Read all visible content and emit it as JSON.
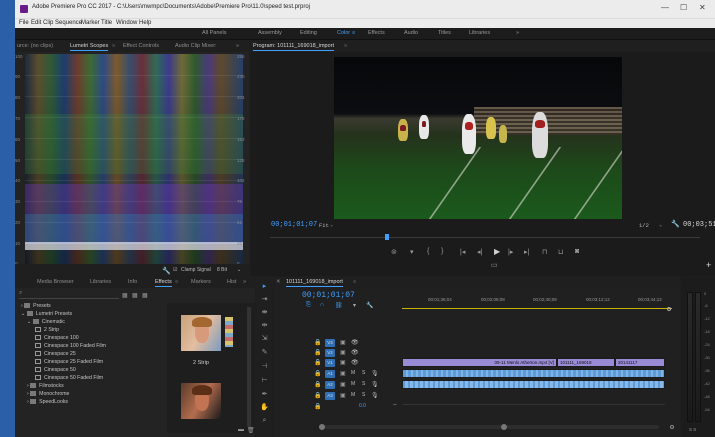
{
  "window": {
    "title": "Adobe Premiere Pro CC 2017 - C:\\Users\\mwmpc\\Documents\\Adobe\\Premiere Pro\\11.0\\speed test.prproj",
    "controls": [
      "—",
      "☐",
      "✕"
    ]
  },
  "menubar": [
    "File",
    "Edit",
    "Clip",
    "Sequence",
    "Marker",
    "Title",
    "Window",
    "Help"
  ],
  "workspaces": {
    "items": [
      "All Panels",
      "Assembly",
      "Editing",
      "Color",
      "Effects",
      "Audio",
      "Titles",
      "Libraries"
    ],
    "active": "Color",
    "more": "»"
  },
  "scope_panel": {
    "tabs": [
      "urce: (no clips)",
      "Lumetri Scopes",
      "Effect Controls",
      "Audio Clip Mixer:"
    ],
    "active_tab": "Lumetri Scopes",
    "more": "»",
    "left_scale": [
      "100",
      "90",
      "80",
      "70",
      "60",
      "50",
      "40",
      "30",
      "20",
      "10",
      "0"
    ],
    "right_scale": [
      "255",
      "230",
      "204",
      "178",
      "153",
      "128",
      "102",
      "76",
      "51",
      "25",
      "0"
    ],
    "clamp_label": "Clamp Signal",
    "bit_depth": "8 Bit"
  },
  "program": {
    "tab": "Program: 101111_169018_import",
    "timecode": "00;01;01;07",
    "fit": "Fit",
    "resolution": "1/2",
    "duration": "00;03;51;43"
  },
  "effects_panel": {
    "tabs": [
      "Media Browser",
      "Libraries",
      "Info",
      "Effects",
      "Markers",
      "Hist"
    ],
    "active_tab": "Effects",
    "more": "»",
    "items": [
      {
        "label": "Presets",
        "kind": "folder",
        "indent": 0
      },
      {
        "label": "Lumetri Presets",
        "kind": "folder",
        "indent": 0
      },
      {
        "label": "Cinematic",
        "kind": "folder",
        "indent": 1
      },
      {
        "label": "2 Strip",
        "kind": "preset",
        "indent": 2
      },
      {
        "label": "Cinespace 100",
        "kind": "preset",
        "indent": 2
      },
      {
        "label": "Cinespace 100 Faded Film",
        "kind": "preset",
        "indent": 2
      },
      {
        "label": "Cinespace 25",
        "kind": "preset",
        "indent": 2
      },
      {
        "label": "Cinespace 25 Faded Film",
        "kind": "preset",
        "indent": 2
      },
      {
        "label": "Cinespace 50",
        "kind": "preset",
        "indent": 2
      },
      {
        "label": "Cinespace 50 Faded Film",
        "kind": "preset",
        "indent": 2
      },
      {
        "label": "Filmstocks",
        "kind": "folder",
        "indent": 1
      },
      {
        "label": "Monochrome",
        "kind": "folder",
        "indent": 1
      },
      {
        "label": "SpeedLooks",
        "kind": "folder",
        "indent": 1
      }
    ],
    "preview_label": "2 Strip"
  },
  "timeline": {
    "tab": "101111_169018_import",
    "timecode": "00;01;01;07",
    "ruler": [
      "00;01;36;04",
      "00;02;08;08",
      "00;02;40;08",
      "00;03;12;12",
      "00;03;44;12"
    ],
    "video_tracks": [
      "V3",
      "V2",
      "V1"
    ],
    "audio_tracks": [
      "A1",
      "A2",
      "A3"
    ],
    "master_value": "0.0",
    "clips": {
      "v1_a": "09-11 Menlo Atherton.mp4 [V]",
      "v1_b": "101111_169018",
      "v1_c": "20141117"
    }
  },
  "meters": {
    "scale": [
      "0",
      "-6",
      "-12",
      "-18",
      "-24",
      "-30",
      "-36",
      "-42",
      "-48",
      "-54"
    ],
    "footer": "S S"
  }
}
